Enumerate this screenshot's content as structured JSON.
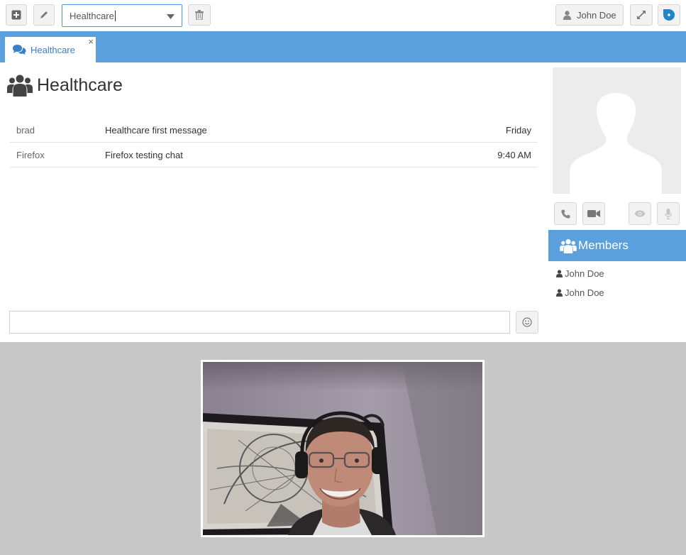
{
  "toolbar": {
    "add_icon": "plus-square-icon",
    "edit_icon": "pencil-icon",
    "room_select_value": "Healthcare",
    "delete_icon": "trash-icon",
    "user_label": "John Doe",
    "expand_icon": "expand-icon",
    "brand_icon": "brand-logo-icon"
  },
  "tabs": [
    {
      "label": "Healthcare",
      "icon": "comments-icon",
      "close": "×"
    }
  ],
  "room": {
    "title": "Healthcare",
    "icon": "users-icon"
  },
  "messages": [
    {
      "sender": "brad",
      "text": "Healthcare first message",
      "time": "Friday"
    },
    {
      "sender": "Firefox",
      "text": "Firefox testing chat",
      "time": "9:40 AM"
    }
  ],
  "chat_input": {
    "value": "",
    "placeholder": ""
  },
  "members": {
    "title": "Members",
    "list": [
      {
        "name": "John Doe"
      },
      {
        "name": "John Doe"
      }
    ]
  },
  "colors": {
    "accent": "#5b9fdd",
    "tab_text": "#3a80c9",
    "brand": "#1f86c8"
  }
}
